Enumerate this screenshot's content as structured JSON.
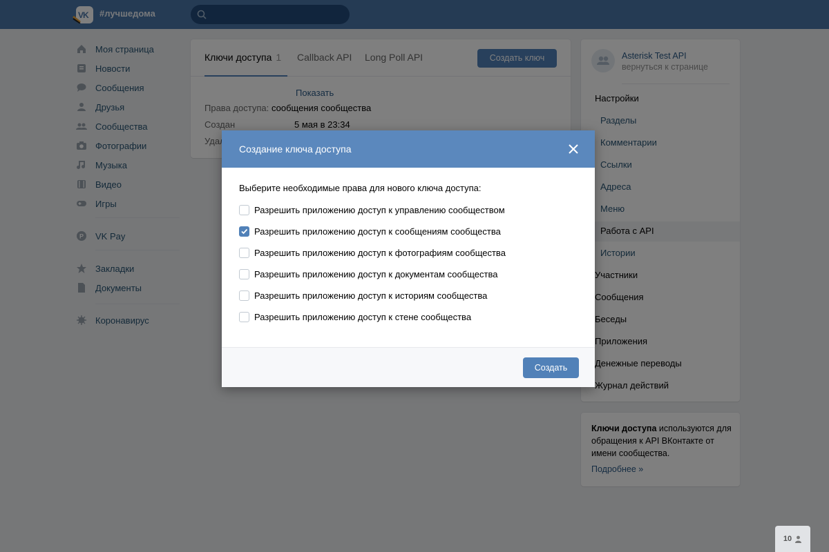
{
  "header": {
    "logo_text": "VK",
    "hashtag": "#лучшедома",
    "search_placeholder": ""
  },
  "leftnav": {
    "items": [
      {
        "label": "Моя страница",
        "icon": "home-icon"
      },
      {
        "label": "Новости",
        "icon": "news-icon"
      },
      {
        "label": "Сообщения",
        "icon": "messages-icon"
      },
      {
        "label": "Друзья",
        "icon": "friends-icon"
      },
      {
        "label": "Сообщества",
        "icon": "communities-icon"
      },
      {
        "label": "Фотографии",
        "icon": "camera-icon"
      },
      {
        "label": "Музыка",
        "icon": "music-note-icon"
      },
      {
        "label": "Видео",
        "icon": "film-icon"
      },
      {
        "label": "Игры",
        "icon": "gamepad-icon"
      },
      {
        "label": "VK Pay",
        "icon": "vkpay-icon"
      },
      {
        "label": "Закладки",
        "icon": "star-icon"
      },
      {
        "label": "Документы",
        "icon": "document-icon"
      },
      {
        "label": "Коронавирус",
        "icon": "virus-icon"
      }
    ]
  },
  "main": {
    "tabs": [
      {
        "label": "Ключи доступа",
        "count": "1"
      },
      {
        "label": "Callback API"
      },
      {
        "label": "Long Poll API"
      }
    ],
    "create_button": "Создать ключ",
    "key_show_link": "Показать",
    "rows": [
      {
        "label": "Права доступа:",
        "value": "сообщения сообщества"
      },
      {
        "label": "Создан",
        "value": "5 мая в 23:34"
      },
      {
        "label": "Удал",
        "value": ""
      }
    ]
  },
  "right": {
    "owner_name": "Asterisk Test API",
    "owner_back": "вернуться к странице",
    "menu": [
      {
        "label": "Настройки",
        "level": "top"
      },
      {
        "label": "Разделы",
        "level": "sub"
      },
      {
        "label": "Комментарии",
        "level": "sub"
      },
      {
        "label": "Ссылки",
        "level": "sub"
      },
      {
        "label": "Адреса",
        "level": "sub"
      },
      {
        "label": "Меню",
        "level": "sub"
      },
      {
        "label": "Работа с API",
        "level": "sub",
        "active": true
      },
      {
        "label": "Истории",
        "level": "sub"
      },
      {
        "label": "Участники",
        "level": "top"
      },
      {
        "label": "Сообщения",
        "level": "top"
      },
      {
        "label": "Беседы",
        "level": "top"
      },
      {
        "label": "Приложения",
        "level": "top"
      },
      {
        "label": "Денежные переводы",
        "level": "top"
      },
      {
        "label": "Журнал действий",
        "level": "top"
      }
    ],
    "info_bold": "Ключи доступа",
    "info_rest": " используются для обращения к API ВКонтакте от имени сообщества.",
    "info_more": "Подробнее »"
  },
  "modal": {
    "title": "Создание ключа доступа",
    "intro": "Выберите необходимые права для нового ключа доступа:",
    "permissions": [
      {
        "label": "Разрешить приложению доступ к управлению сообществом",
        "checked": false
      },
      {
        "label": "Разрешить приложению доступ к сообщениям сообщества",
        "checked": true
      },
      {
        "label": "Разрешить приложению доступ к фотографиям сообщества",
        "checked": false
      },
      {
        "label": "Разрешить приложению доступ к документам сообщества",
        "checked": false
      },
      {
        "label": "Разрешить приложению доступ к историям сообщества",
        "checked": false
      },
      {
        "label": "Разрешить приложению доступ к стене сообщества",
        "checked": false
      }
    ],
    "create_button": "Создать"
  },
  "counter": {
    "value": "10",
    "icon": "person-icon"
  },
  "colors": {
    "header": "#4a76a8",
    "accent": "#5181b8",
    "modal_header": "#5b88bd"
  }
}
